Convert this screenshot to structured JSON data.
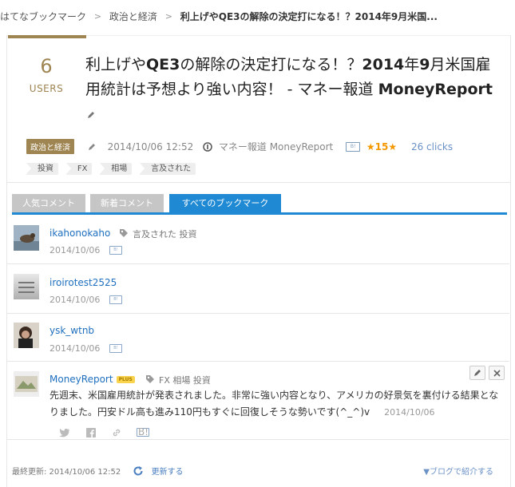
{
  "breadcrumb": {
    "items": [
      "はてなブックマーク",
      "政治と経済",
      "利上げやQE3の解除の決定打になる！？2014年9月米国..."
    ],
    "separator": ">"
  },
  "entry": {
    "users_count": "6",
    "users_label": "USERS",
    "title_parts": [
      "利上げや",
      "QE3",
      "の解除の決定打になる！？",
      "2014",
      "年",
      "9",
      "月米国雇用統計は予想より強い内容！ - マネー報道 ",
      "MoneyReport"
    ],
    "category": "政治と経済",
    "date": "2014/10/06 12:52",
    "site": "マネー報道 MoneyReport",
    "stars": "★15★",
    "clicks": "26 clicks",
    "tags": [
      "投資",
      "FX",
      "相場",
      "言及された"
    ]
  },
  "tabs": [
    {
      "label": "人気コメント",
      "active": false
    },
    {
      "label": "新着コメント",
      "active": false
    },
    {
      "label": "すべてのブックマーク",
      "active": true
    }
  ],
  "bookmarks": [
    {
      "user": "ikahonokaho",
      "tags": "言及された  投資",
      "date": "2014/10/06"
    },
    {
      "user": "iroirotest2525",
      "tags": "",
      "date": "2014/10/06"
    },
    {
      "user": "ysk_wtnb",
      "tags": "",
      "date": "2014/10/06"
    },
    {
      "user": "MoneyReport",
      "badge": "PLUS",
      "tags": "FX  相場  投資",
      "comment": "先週末、米国雇用統計が発表されました。非常に強い内容となり、アメリカの好景気を裏付ける結果となりました。円安ドル高も進み110円もすぐに回復しそうな勢いです(^_^)v",
      "date": "2014/10/06"
    }
  ],
  "footer": {
    "last_updated": "最終更新: 2014/10/06 12:52",
    "refresh": "更新する",
    "blog_intro": "▼ブログで紹介する"
  },
  "colors": {
    "accent": "#9e8552",
    "tab_active": "#1f8ad3",
    "link": "#1e6fbf",
    "star": "#f39800"
  }
}
